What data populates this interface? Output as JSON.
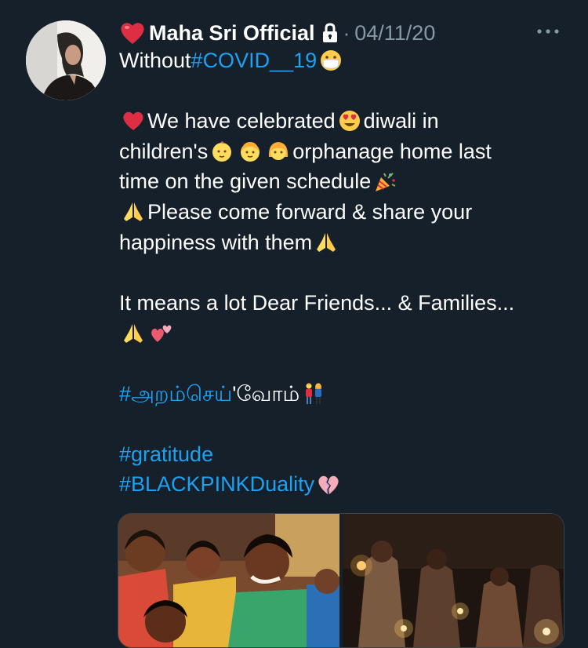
{
  "tweet": {
    "display_name": "Maha Sri Official",
    "timestamp": "04/11/20",
    "separator": "·",
    "lines": {
      "l1_text": "Without ",
      "l1_hashtag": "#COVID__19",
      "l2_text": "We have celebrated ",
      "l2_text2": "diwali in",
      "l3_text": "children's ",
      "l3_text2": "orphanage home last",
      "l4_text": "time on the given schedule",
      "l5_text": "Please come forward & share your",
      "l6_text": "happiness with them ",
      "l7_text": "It means a lot Dear Friends... & Families...",
      "l9_hashtag": "#அறம்செய்",
      "l9_text": "'வோம்",
      "l10_hashtag": "#gratitude",
      "l11_hashtag": "#BLACKPINKDuality"
    },
    "icons": [
      "red-heart",
      "lock",
      "more-dots",
      "mask-face",
      "heart-eyes",
      "baby",
      "boy",
      "girl",
      "party-popper",
      "folded-hands",
      "two-hearts",
      "couple",
      "broken-heart"
    ],
    "colors": {
      "background": "#15202b",
      "text": "#ffffff",
      "secondary": "#8899a6",
      "hashtag": "#1da1f2"
    }
  }
}
